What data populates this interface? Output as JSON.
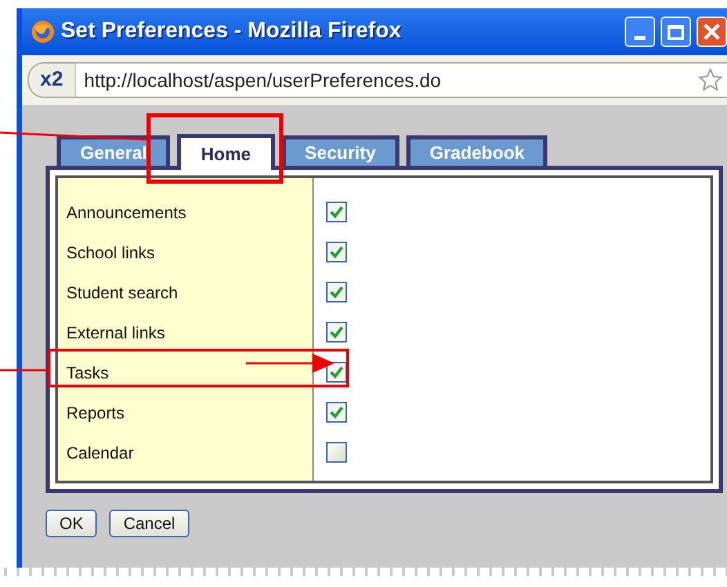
{
  "window": {
    "title": "Set Preferences - Mozilla Firefox"
  },
  "address_bar": {
    "site_badge": "x2",
    "url": "http://localhost/aspen/userPreferences.do"
  },
  "tabs": [
    {
      "label": "General",
      "selected": false
    },
    {
      "label": "Home",
      "selected": true
    },
    {
      "label": "Security",
      "selected": false
    },
    {
      "label": "Gradebook",
      "selected": false
    }
  ],
  "preferences": [
    {
      "label": "Announcements",
      "checked": true
    },
    {
      "label": "School links",
      "checked": true
    },
    {
      "label": "Student search",
      "checked": true
    },
    {
      "label": "External links",
      "checked": true
    },
    {
      "label": "Tasks",
      "checked": true
    },
    {
      "label": "Reports",
      "checked": true
    },
    {
      "label": "Calendar",
      "checked": false
    }
  ],
  "buttons": [
    "OK",
    "Cancel"
  ]
}
